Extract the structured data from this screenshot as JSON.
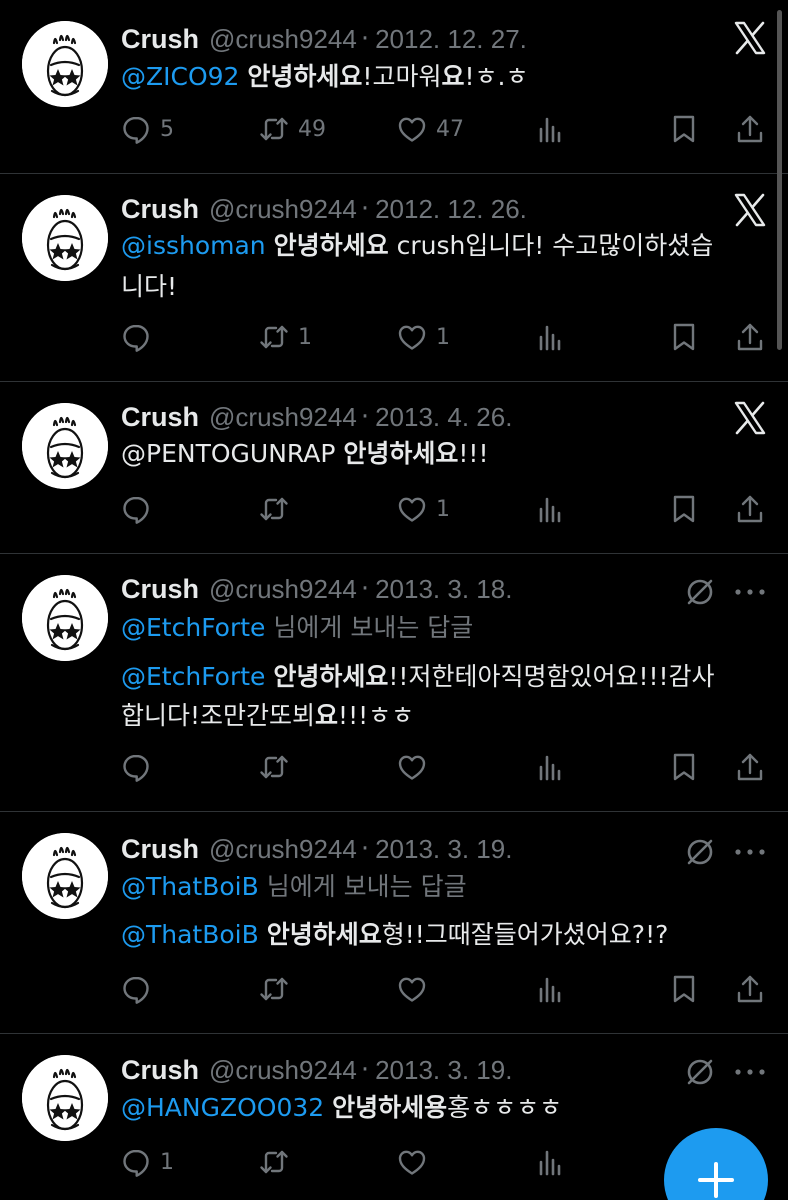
{
  "tweets": [
    {
      "name": "Crush",
      "handle": "@crush9244",
      "separator": "·",
      "date": "2012. 12. 27.",
      "top_icon": "x-logo-icon",
      "lines": [
        [
          {
            "t": "@ZICO92",
            "s": "mention"
          },
          {
            "t": " ",
            "s": ""
          },
          {
            "t": "안녕하세요",
            "s": "bold"
          },
          {
            "t": "!고마워",
            "s": ""
          },
          {
            "t": "요",
            "s": "bold"
          },
          {
            "t": "!ㅎ.ㅎ",
            "s": ""
          }
        ]
      ],
      "replies": "5",
      "reposts": "49",
      "likes": "47"
    },
    {
      "name": "Crush",
      "handle": "@crush9244",
      "separator": "·",
      "date": "2012. 12. 26.",
      "top_icon": "x-logo-icon",
      "lines": [
        [
          {
            "t": "@isshoman",
            "s": "mention"
          },
          {
            "t": " ",
            "s": ""
          },
          {
            "t": "안녕하세요",
            "s": "bold"
          },
          {
            "t": " crush입니다! 수고많이하셨습",
            "s": ""
          }
        ],
        [
          {
            "t": "니다!",
            "s": ""
          }
        ]
      ],
      "replies": "",
      "reposts": "1",
      "likes": "1"
    },
    {
      "name": "Crush",
      "handle": "@crush9244",
      "separator": "·",
      "date": "2013. 4. 26.",
      "top_icon": "x-logo-icon",
      "lines": [
        [
          {
            "t": "@PENTOGUNRAP ",
            "s": ""
          },
          {
            "t": "안녕하세요",
            "s": "bold"
          },
          {
            "t": "!!!",
            "s": ""
          }
        ]
      ],
      "replies": "",
      "reposts": "",
      "likes": "1"
    },
    {
      "name": "Crush",
      "handle": "@crush9244",
      "separator": "·",
      "date": "2013. 3. 18.",
      "top_icon": "no-repost-icon",
      "reply_to": [
        {
          "t": "@EtchForte",
          "s": "mention"
        },
        {
          "t": " 님에게 보내는 답글",
          "s": "grey"
        }
      ],
      "lines": [
        [
          {
            "t": "@EtchForte",
            "s": "mention"
          },
          {
            "t": " ",
            "s": ""
          },
          {
            "t": "안녕하세요",
            "s": "bold"
          },
          {
            "t": "!!저한테아직명함있어요!!!감사",
            "s": ""
          }
        ],
        [
          {
            "t": "합니다!조만간또뵈",
            "s": ""
          },
          {
            "t": "요",
            "s": "bold"
          },
          {
            "t": "!!!ㅎㅎ",
            "s": ""
          }
        ]
      ],
      "replies": "",
      "reposts": "",
      "likes": ""
    },
    {
      "name": "Crush",
      "handle": "@crush9244",
      "separator": "·",
      "date": "2013. 3. 19.",
      "top_icon": "no-repost-icon",
      "reply_to": [
        {
          "t": "@ThatBoiB",
          "s": "mention"
        },
        {
          "t": " 님에게 보내는 답글",
          "s": "grey"
        }
      ],
      "lines": [
        [
          {
            "t": "@ThatBoiB",
            "s": "mention"
          },
          {
            "t": " ",
            "s": ""
          },
          {
            "t": "안녕하세요",
            "s": "bold"
          },
          {
            "t": "형!!그때잘들어가셨어요?!?",
            "s": ""
          }
        ]
      ],
      "replies": "",
      "reposts": "",
      "likes": ""
    },
    {
      "name": "Crush",
      "handle": "@crush9244",
      "separator": "·",
      "date": "2013. 3. 19.",
      "top_icon": "no-repost-icon",
      "lines": [
        [
          {
            "t": "@HANGZOO032",
            "s": "mention"
          },
          {
            "t": " ",
            "s": ""
          },
          {
            "t": "안녕하세용",
            "s": "bold"
          },
          {
            "t": "홍ㅎㅎㅎㅎ",
            "s": ""
          }
        ]
      ],
      "replies": "1",
      "reposts": "",
      "likes": ""
    }
  ],
  "fab": {
    "icon": "plus-icon",
    "color": "#1d9bf0"
  },
  "colors": {
    "mention": "#1d9bf0",
    "muted": "#71767b",
    "text": "#e7e9ea",
    "background": "#000000"
  }
}
